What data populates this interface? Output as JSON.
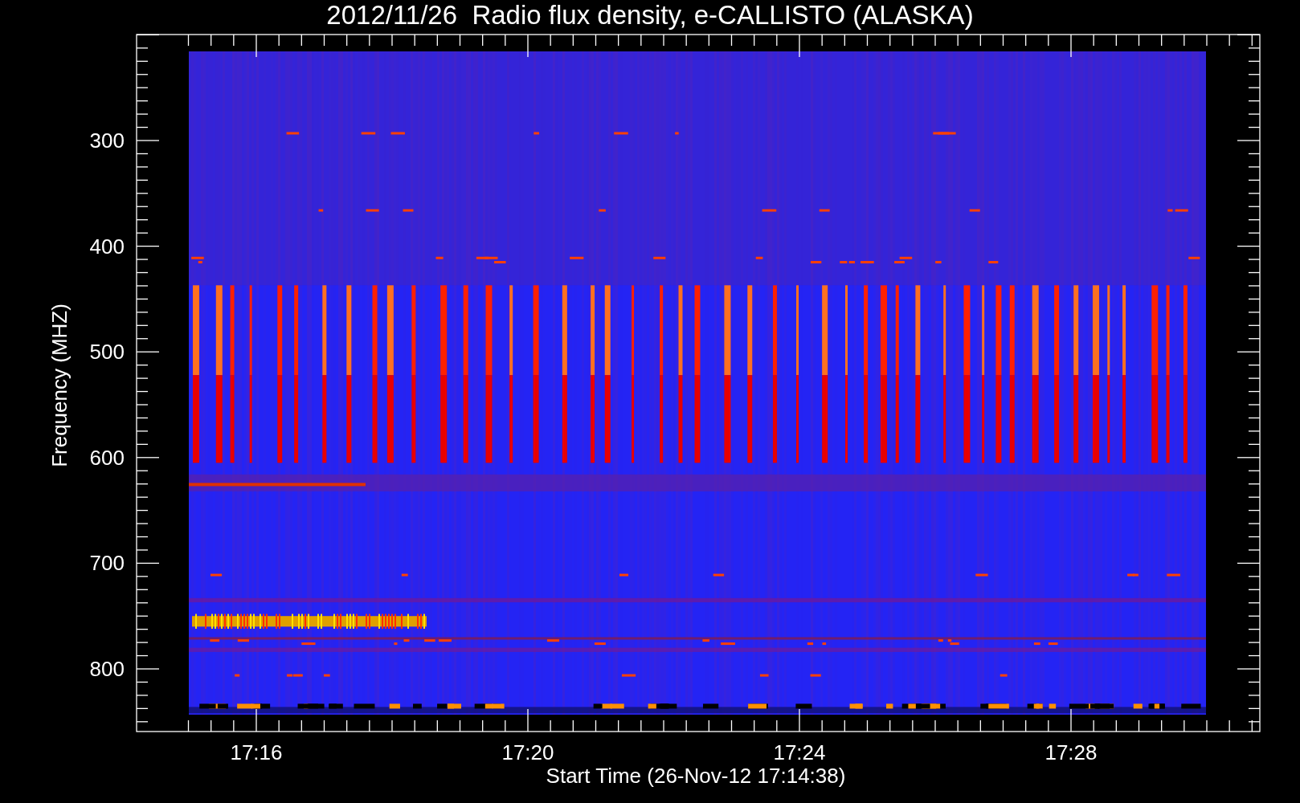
{
  "title": "2012/11/26  Radio flux density, e-CALLISTO (ALASKA)",
  "plot": {
    "ylabel": "Frequency (MHZ)",
    "xlabel": "Start Time (26-Nov-12 17:14:38)",
    "yticks": [
      {
        "label": "300"
      },
      {
        "label": "400"
      },
      {
        "label": "500"
      },
      {
        "label": "600"
      },
      {
        "label": "700"
      },
      {
        "label": "800"
      }
    ],
    "xticks": [
      {
        "label": "17:16"
      },
      {
        "label": "17:20"
      },
      {
        "label": "17:24"
      },
      {
        "label": "17:28"
      }
    ]
  }
}
